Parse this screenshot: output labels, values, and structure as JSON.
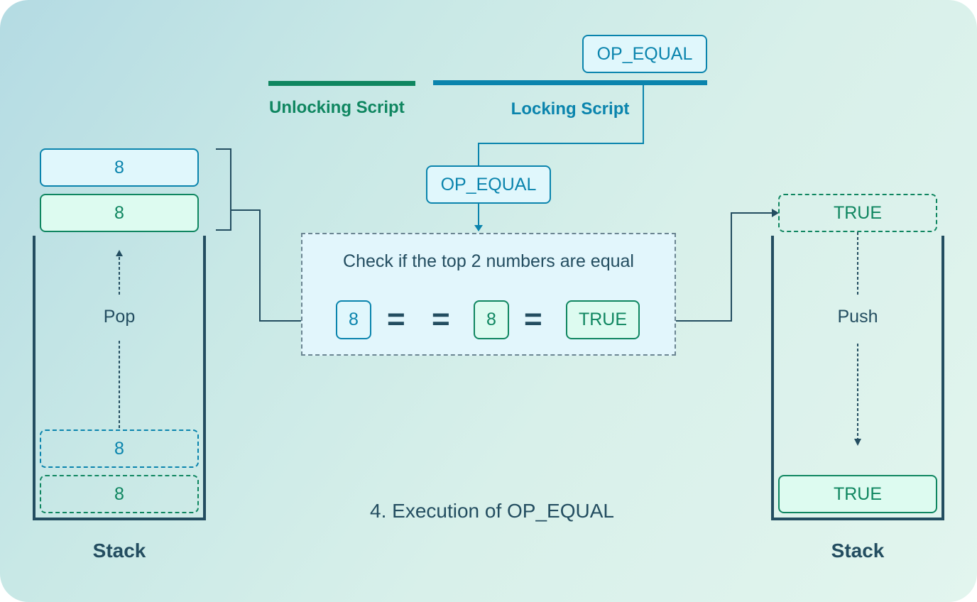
{
  "caption": "4. Execution of OP_EQUAL",
  "header": {
    "unlocking_label": "Unlocking Script",
    "locking_label": "Locking Script",
    "locking_opcode": "OP_EQUAL",
    "colors": {
      "unlocking": "#0f8660",
      "locking": "#0a84ad"
    }
  },
  "current_opcode": "OP_EQUAL",
  "left_stack": {
    "title": "Stack",
    "action": "Pop",
    "popped_items": [
      {
        "value": "8",
        "source": "locking"
      },
      {
        "value": "8",
        "source": "unlocking"
      }
    ],
    "ghost_items": [
      {
        "value": "8",
        "source": "locking"
      },
      {
        "value": "8",
        "source": "unlocking"
      }
    ]
  },
  "operation": {
    "description": "Check if the top 2 numbers are equal",
    "left_operand": "8",
    "operator": "==",
    "right_operand": "8",
    "result_sign": "=",
    "result": "TRUE"
  },
  "right_stack": {
    "title": "Stack",
    "action": "Push",
    "incoming_item": "TRUE",
    "items": [
      {
        "value": "TRUE"
      }
    ]
  }
}
